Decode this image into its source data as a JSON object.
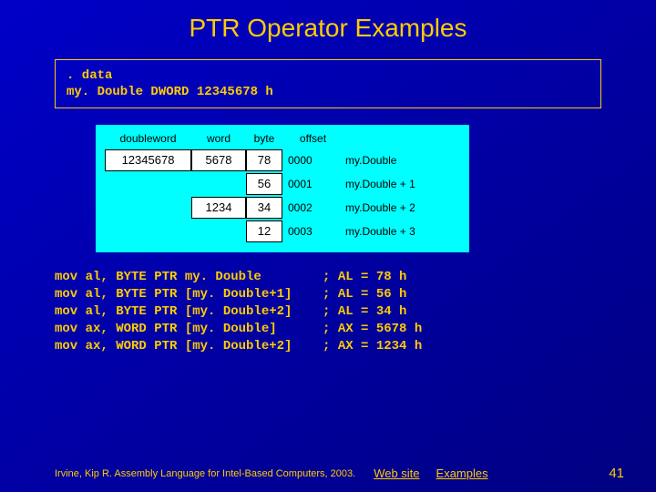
{
  "title": "PTR Operator Examples",
  "data_block": {
    "line1": ". data",
    "line2": "my. Double DWORD 12345678 h"
  },
  "mem": {
    "headers": {
      "dw": "doubleword",
      "w": "word",
      "b": "byte",
      "off": "offset"
    },
    "rows": [
      {
        "dw": "12345678",
        "w": "5678",
        "b": "78",
        "off": "0000",
        "label": "my.Double"
      },
      {
        "dw": "",
        "w": "",
        "b": "56",
        "off": "0001",
        "label": "my.Double + 1"
      },
      {
        "dw": "",
        "w": "1234",
        "b": "34",
        "off": "0002",
        "label": "my.Double + 2"
      },
      {
        "dw": "",
        "w": "",
        "b": "12",
        "off": "0003",
        "label": "my.Double + 3"
      }
    ]
  },
  "code_lines": [
    "mov al, BYTE PTR my. Double        ; AL = 78 h",
    "mov al, BYTE PTR [my. Double+1]    ; AL = 56 h",
    "mov al, BYTE PTR [my. Double+2]    ; AL = 34 h",
    "mov ax, WORD PTR [my. Double]      ; AX = 5678 h",
    "mov ax, WORD PTR [my. Double+2]    ; AX = 1234 h"
  ],
  "footer": {
    "cite": "Irvine, Kip R. Assembly Language for Intel-Based Computers, 2003.",
    "link1": "Web site",
    "link2": "Examples",
    "page": "41"
  }
}
